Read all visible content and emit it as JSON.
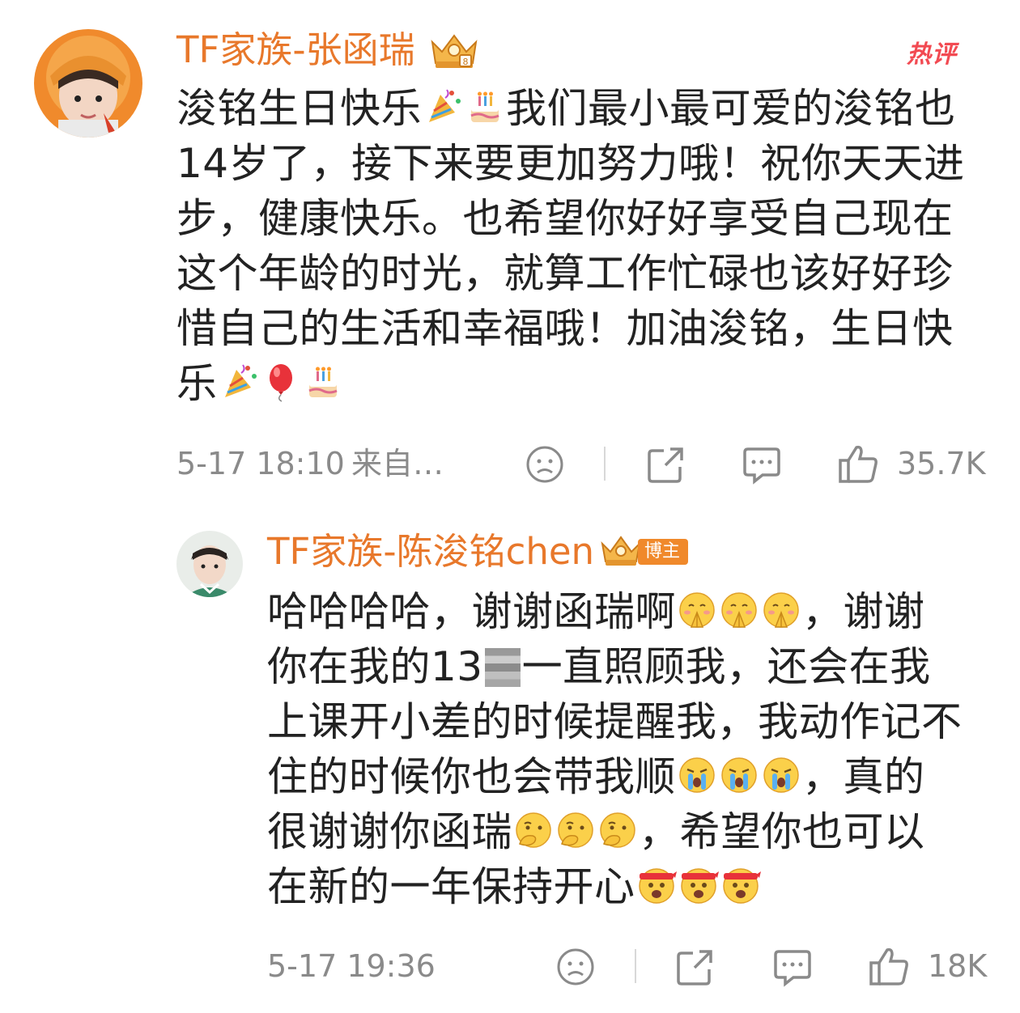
{
  "comment1": {
    "username": "TF家族-张函瑞",
    "hot_label": "热评",
    "content_parts": [
      "浚铭生日快乐",
      "我们最小最可爱的浚铭也14岁了，接下来要更加努力哦！祝你天天进步，健康快乐。也希望你好好享受自己现在这个年龄的时光，就算工作忙碌也该好好珍惜自己的生活和幸福哦！加油浚铭，生日快乐"
    ],
    "emoji": [
      "party-popper-icon",
      "birthday-cake-icon",
      "balloon-icon"
    ],
    "time": "5-17 18:10",
    "source": "来自…",
    "like_count": "35.7K"
  },
  "comment2": {
    "username": "TF家族-陈浚铭chen",
    "blogger_tag": "博主",
    "content_parts": [
      "哈哈哈哈，谢谢函瑞啊",
      "，谢谢你在我的13",
      "一直照顾我，还会在我上课开小差的时候提醒我，我动作记不住的时候你也会带我顺",
      "，真的很谢谢你函瑞",
      "，希望你也可以在新的一年保持开心"
    ],
    "emoji": [
      "pray-face-icon",
      "crying-face-icon",
      "thinking-face-icon",
      "cheer-face-icon"
    ],
    "time": "5-17 19:36",
    "like_count": "18K"
  },
  "colors": {
    "username": "#e8782b",
    "hot": "#f24a52",
    "meta": "#8a8a8a",
    "text": "#222222"
  }
}
